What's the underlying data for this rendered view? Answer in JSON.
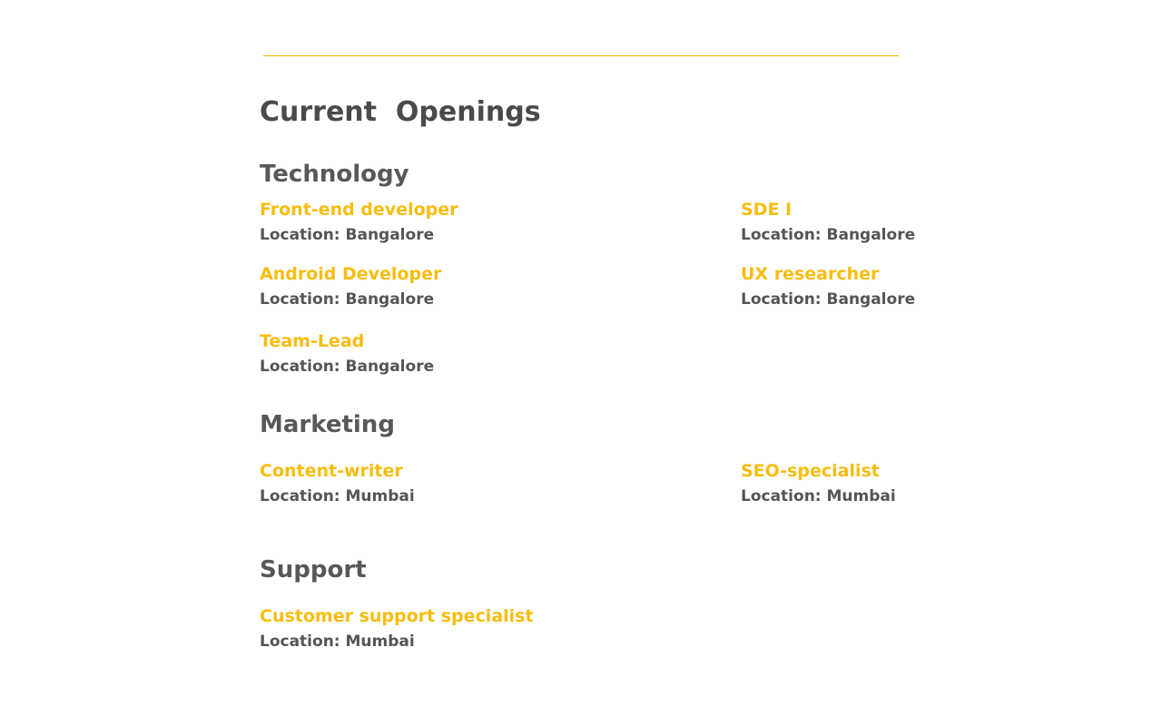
{
  "header": {
    "title": "Current  Openings",
    "accent_color": "#f2b705"
  },
  "colors": {
    "job_title": "#f7bd0f",
    "text": "#555555"
  },
  "sections": {
    "technology": {
      "title": "Technology",
      "jobs": [
        {
          "title": "Front-end developer",
          "location": "Location: Bangalore"
        },
        {
          "title": "SDE I",
          "location": "Location: Bangalore"
        },
        {
          "title": "Android Developer",
          "location": "Location: Bangalore"
        },
        {
          "title": "UX researcher",
          "location": "Location: Bangalore"
        },
        {
          "title": "Team-Lead",
          "location": "Location: Bangalore"
        }
      ]
    },
    "marketing": {
      "title": "Marketing",
      "jobs": [
        {
          "title": "Content-writer",
          "location": "Location: Mumbai"
        },
        {
          "title": "SEO-specialist",
          "location": "Location: Mumbai"
        }
      ]
    },
    "support": {
      "title": "Support",
      "jobs": [
        {
          "title": "Customer support specialist",
          "location": "Location: Mumbai"
        }
      ]
    }
  }
}
